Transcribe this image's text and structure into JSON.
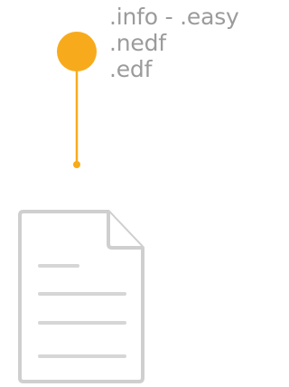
{
  "marker": {
    "icon": "pin-marker",
    "color": "#F7AB1C"
  },
  "extensions": [
    ".info - .easy",
    ".nedf",
    ".edf"
  ],
  "document": {
    "icon": "file-document-icon",
    "stroke_color": "#CFCFCF",
    "line_color": "#D6D6D6"
  }
}
